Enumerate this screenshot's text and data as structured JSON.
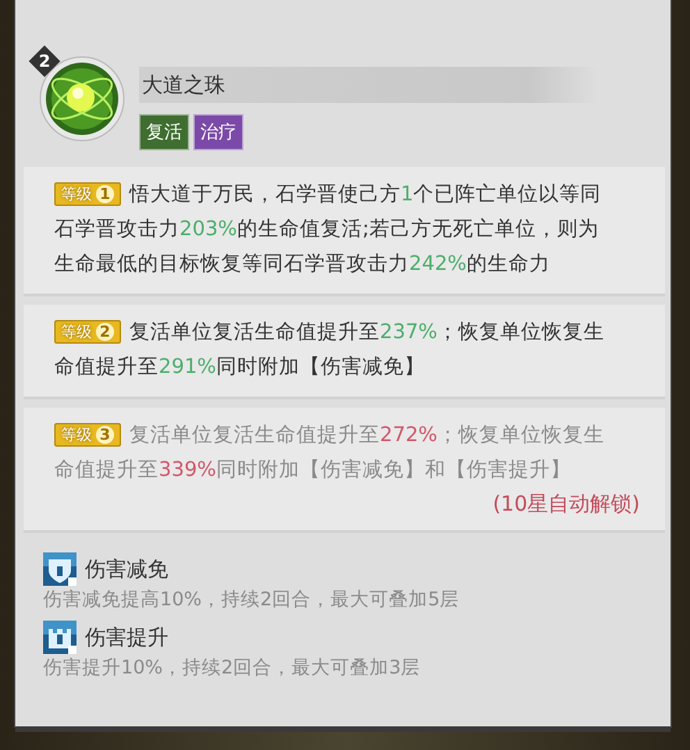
{
  "skill": {
    "rank": "2",
    "name": "大道之珠",
    "tags": [
      {
        "label": "复活",
        "color": "#3f6e30"
      },
      {
        "label": "治疗",
        "color": "#7b4aa8"
      }
    ]
  },
  "levels": [
    {
      "badge": "等级",
      "number": "1",
      "unlocked": true,
      "parts": [
        {
          "kind": "text",
          "text": "悟大道于万民，石学晋使己方"
        },
        {
          "kind": "value",
          "text": "1"
        },
        {
          "kind": "text",
          "text": "个已阵亡单位以等同石学晋攻击力"
        },
        {
          "kind": "value",
          "text": "203%"
        },
        {
          "kind": "text",
          "text": "的生命值复活;若己方无死亡单位，则为生命最低的目标恢复等同石学晋攻击力"
        },
        {
          "kind": "value",
          "text": "242%"
        },
        {
          "kind": "text",
          "text": "的生命力"
        }
      ]
    },
    {
      "badge": "等级",
      "number": "2",
      "unlocked": true,
      "parts": [
        {
          "kind": "text",
          "text": "复活单位复活生命值提升至"
        },
        {
          "kind": "value",
          "text": "237%"
        },
        {
          "kind": "text",
          "text": "；恢复单位恢复生命值提升至"
        },
        {
          "kind": "value",
          "text": "291%"
        },
        {
          "kind": "text",
          "text": "同时附加【伤害减免】"
        }
      ]
    },
    {
      "badge": "等级",
      "number": "3",
      "unlocked": false,
      "parts": [
        {
          "kind": "text",
          "text": "复活单位复活生命值提升至"
        },
        {
          "kind": "value",
          "text": "272%"
        },
        {
          "kind": "text",
          "text": "；恢复单位恢复生命值提升至"
        },
        {
          "kind": "value",
          "text": "339%"
        },
        {
          "kind": "text",
          "text": "同时附加【伤害减免】和【伤害提升】"
        }
      ],
      "unlock_note": "(10星自动解锁)"
    }
  ],
  "buffs": [
    {
      "name": "伤害减免",
      "description": "伤害减免提高10%，持续2回合，最大可叠加5层"
    },
    {
      "name": "伤害提升",
      "description": "伤害提升10%，持续2回合，最大可叠加3层"
    }
  ]
}
